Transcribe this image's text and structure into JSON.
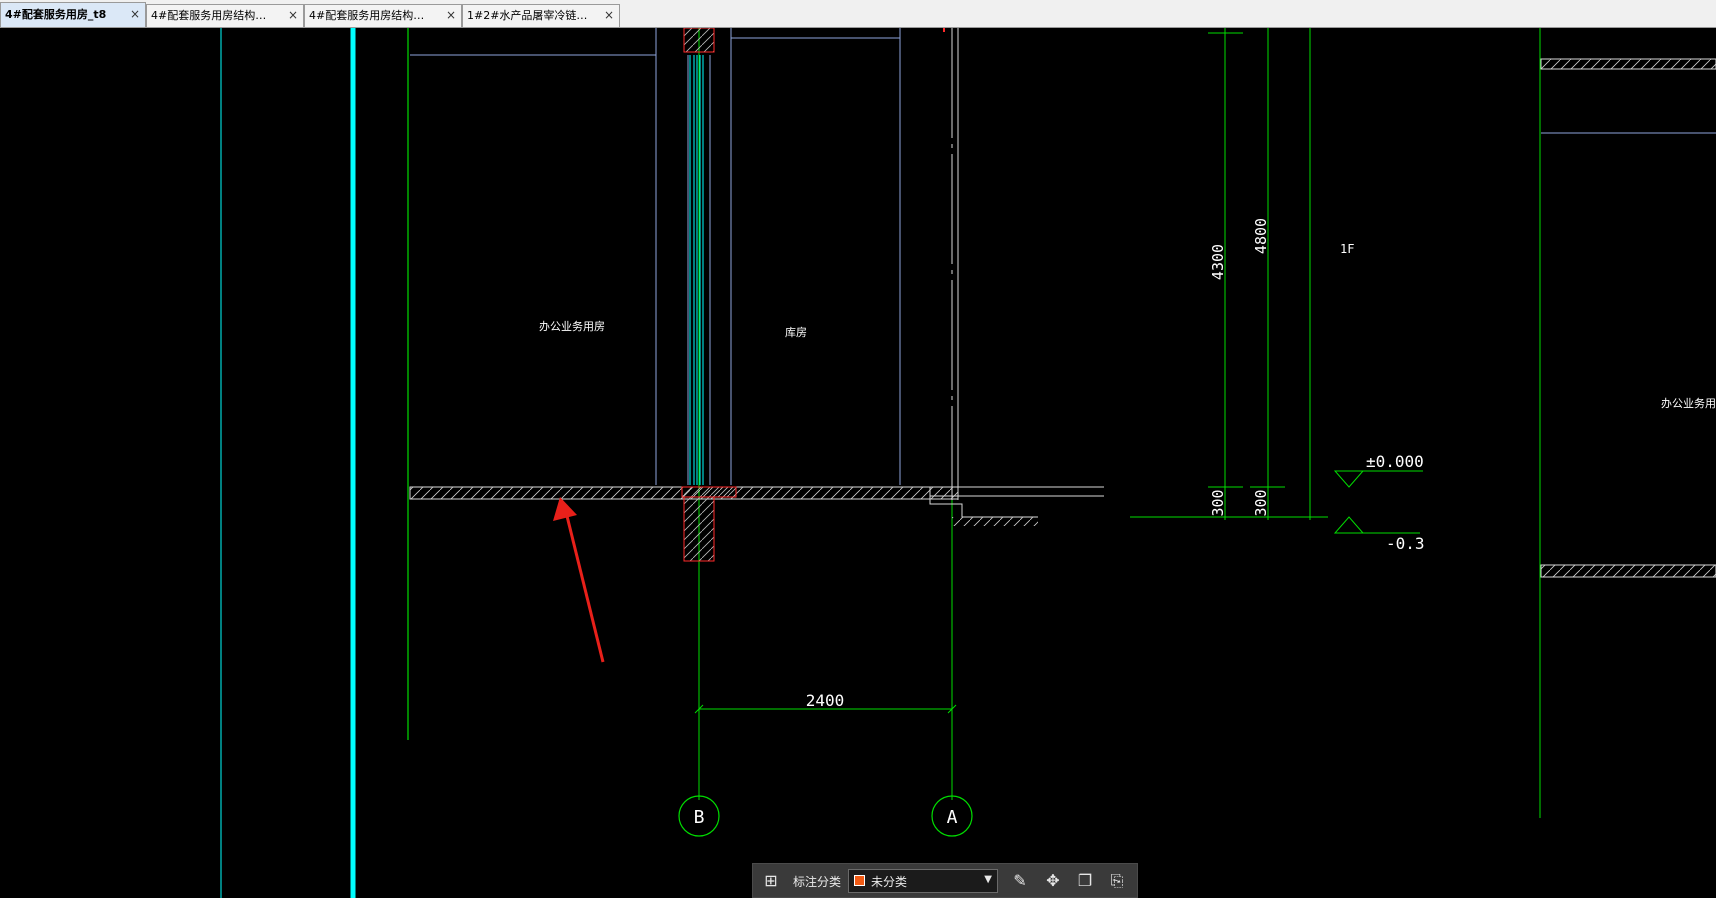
{
  "tabs": [
    {
      "label": "4#配套服务用房_t8",
      "close": "×",
      "active": true
    },
    {
      "label": "4#配套服务用房结构…",
      "close": "×",
      "active": false
    },
    {
      "label": "4#配套服务用房结构…",
      "close": "×",
      "active": false
    },
    {
      "label": "1#2#水产品屠宰冷链…",
      "close": "×",
      "active": false
    }
  ],
  "drawing": {
    "background_color": "#000000",
    "line_colors": {
      "cyan": "#00ffff",
      "green": "#00dd00",
      "blue": "#8ea5dd",
      "red": "#ff2a2a",
      "white": "#d8d8d8"
    },
    "rooms": {
      "office_left": "办公业务用房",
      "storage": "库房",
      "office_right": "办公业务用"
    },
    "floor_label": "1F",
    "dimensions": {
      "height_4300": "4300",
      "height_4800": "4800",
      "base_300_a": "300",
      "base_300_b": "300",
      "span_2400": "2400"
    },
    "elevations": {
      "level_0": "±0.000",
      "level_minus": "-0.3"
    },
    "axis_labels": {
      "b": "B",
      "a": "A"
    },
    "annotation_arrow": {
      "color": "#e8201a"
    }
  },
  "toolbar": {
    "label": "标注分类",
    "category_value": "未分类",
    "category_color": "#f05a14",
    "dropdown_icon": "caret-down-icon",
    "icons": [
      "grid-icon",
      "edit-icon",
      "move-icon",
      "copy-icon",
      "paste-icon"
    ]
  }
}
